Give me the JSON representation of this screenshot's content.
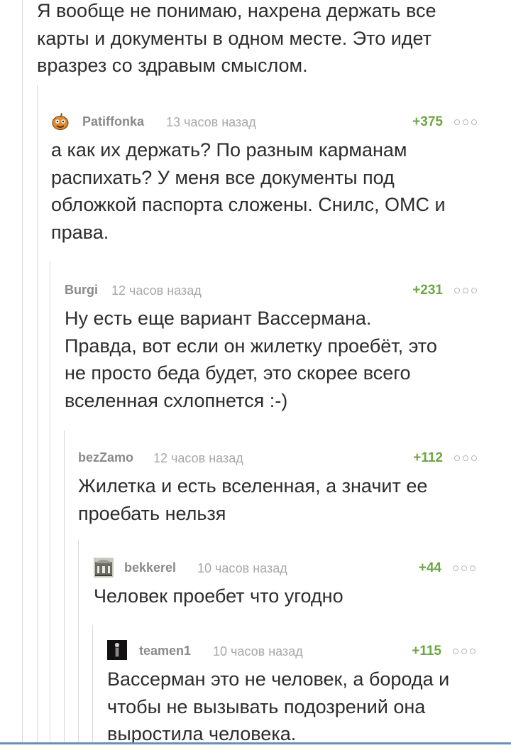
{
  "intro": {
    "text": "Я вообще не понимаю, нахрена держать все\nкарты и документы в одном месте. Это идет\nвразрез со здравым смыслом."
  },
  "comments": [
    {
      "author": "Patiffonka",
      "time": "13 часов назад",
      "rating": "+375",
      "text": "а как их держать? По разным карманам\nраспихать? У меня все документы под\nобложкой паспорта сложены. Снилс, ОМС и\nправа.",
      "avatar": "pumpkin-avatar"
    },
    {
      "author": "Burgi",
      "time": "12 часов назад",
      "rating": "+231",
      "text": "Ну есть еще вариант Вассермана.\nПравда,  вот если он жилетку проебёт, это\nне просто беда будет, это скорее всего\nвселенная схлопнется :-)"
    },
    {
      "author": "bezZamo",
      "time": "12 часов назад",
      "rating": "+112",
      "text": "Жилетка и есть вселенная, а значит ее\nпроебать нельзя"
    },
    {
      "author": "bekkerel",
      "time": "10 часов назад",
      "rating": "+44",
      "text": "Человек проебет что угодно",
      "avatar": "building-avatar"
    },
    {
      "author": "teamen1",
      "time": "10 часов назад",
      "rating": "+115",
      "text": "Вассерман это не человек, а борода и\nчтобы не вызывать подозрений она\nвыростила человека.",
      "avatar": "dark-figure-avatar"
    }
  ],
  "colors": {
    "rating": "#6da646",
    "author": "#8a8a8a",
    "time": "#a8a8a8",
    "thread_line": "#d9d9d9",
    "bottom_bar": "#6a8fb4"
  }
}
